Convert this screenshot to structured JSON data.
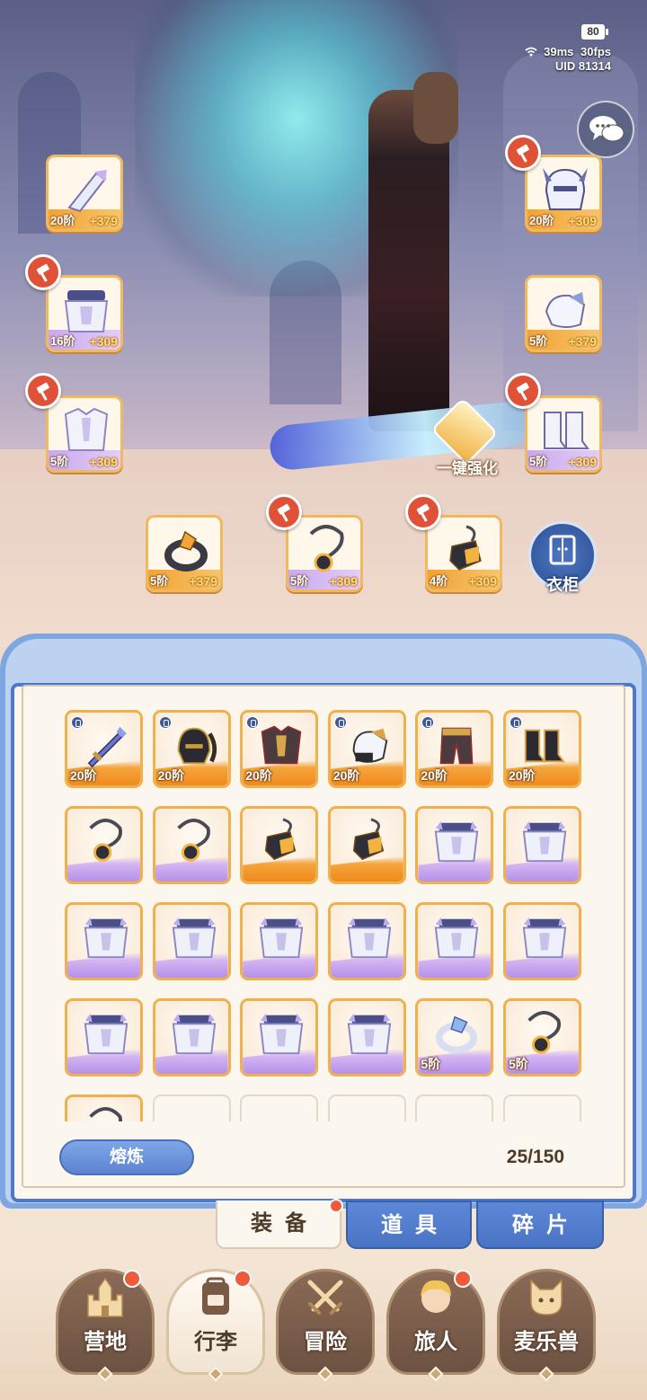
{
  "status": {
    "battery": "80",
    "ping": "39ms",
    "fps": "30fps",
    "uid": "UID  81314"
  },
  "equipped": [
    {
      "tier": "20阶",
      "plus": "+379",
      "item": "bracer",
      "hammer": false
    },
    {
      "tier": "16阶",
      "plus": "+309",
      "item": "armor",
      "hammer": true
    },
    {
      "tier": "5阶",
      "plus": "+309",
      "item": "chest",
      "hammer": true
    },
    {
      "tier": "20阶",
      "plus": "+309",
      "item": "helm",
      "hammer": true
    },
    {
      "tier": "5阶",
      "plus": "+379",
      "item": "gauntlet",
      "hammer": false
    },
    {
      "tier": "5阶",
      "plus": "+309",
      "item": "boots",
      "hammer": true
    },
    {
      "tier": "5阶",
      "plus": "+379",
      "item": "ring",
      "hammer": false
    },
    {
      "tier": "5阶",
      "plus": "+309",
      "item": "necklace",
      "hammer": true
    },
    {
      "tier": "4阶",
      "plus": "+309",
      "item": "pendant",
      "hammer": true
    }
  ],
  "actions": {
    "one_click": "一键强化",
    "wardrobe": "衣柜"
  },
  "inventory": {
    "rows": [
      [
        {
          "tier": "20阶",
          "item": "sword",
          "rarity": "orange",
          "locked": true
        },
        {
          "tier": "20阶",
          "item": "helmet",
          "rarity": "orange",
          "locked": true
        },
        {
          "tier": "20阶",
          "item": "chestplate",
          "rarity": "orange",
          "locked": true
        },
        {
          "tier": "20阶",
          "item": "glove",
          "rarity": "orange",
          "locked": true
        },
        {
          "tier": "20阶",
          "item": "leggings",
          "rarity": "orange",
          "locked": true
        },
        {
          "tier": "20阶",
          "item": "boots",
          "rarity": "orange",
          "locked": true
        }
      ],
      [
        {
          "tier": "",
          "item": "necklace",
          "rarity": "purple",
          "locked": false
        },
        {
          "tier": "",
          "item": "necklace",
          "rarity": "purple",
          "locked": false
        },
        {
          "tier": "",
          "item": "pendant",
          "rarity": "orange",
          "locked": false
        },
        {
          "tier": "",
          "item": "pendant",
          "rarity": "orange",
          "locked": false
        },
        {
          "tier": "",
          "item": "armor",
          "rarity": "purple",
          "locked": false
        },
        {
          "tier": "",
          "item": "armor",
          "rarity": "purple",
          "locked": false
        }
      ],
      [
        {
          "tier": "",
          "item": "armor",
          "rarity": "purple",
          "locked": false
        },
        {
          "tier": "",
          "item": "armor",
          "rarity": "purple",
          "locked": false
        },
        {
          "tier": "",
          "item": "armor",
          "rarity": "purple",
          "locked": false
        },
        {
          "tier": "",
          "item": "armor",
          "rarity": "purple",
          "locked": false
        },
        {
          "tier": "",
          "item": "armor",
          "rarity": "purple",
          "locked": false
        },
        {
          "tier": "",
          "item": "armor",
          "rarity": "purple",
          "locked": false
        }
      ],
      [
        {
          "tier": "",
          "item": "armor",
          "rarity": "purple",
          "locked": false
        },
        {
          "tier": "",
          "item": "armor",
          "rarity": "purple",
          "locked": false
        },
        {
          "tier": "",
          "item": "armor",
          "rarity": "purple",
          "locked": false
        },
        {
          "tier": "",
          "item": "armor",
          "rarity": "purple",
          "locked": false
        },
        {
          "tier": "5阶",
          "item": "ring",
          "rarity": "purple",
          "locked": false
        },
        {
          "tier": "5阶",
          "item": "necklace",
          "rarity": "purple",
          "locked": false
        }
      ],
      [
        {
          "tier": "",
          "item": "necklace",
          "rarity": "purple",
          "locked": false
        },
        {
          "tier": "",
          "item": "",
          "rarity": "empty",
          "locked": false
        },
        {
          "tier": "",
          "item": "",
          "rarity": "empty",
          "locked": false
        },
        {
          "tier": "",
          "item": "",
          "rarity": "empty",
          "locked": false
        },
        {
          "tier": "",
          "item": "",
          "rarity": "empty",
          "locked": false
        },
        {
          "tier": "",
          "item": "",
          "rarity": "empty",
          "locked": false
        }
      ]
    ],
    "smelt_label": "熔炼",
    "capacity": "25/150"
  },
  "tabs": [
    {
      "label": "装备",
      "active": true,
      "badge": true
    },
    {
      "label": "道具",
      "active": false,
      "badge": false
    },
    {
      "label": "碎片",
      "active": false,
      "badge": false
    }
  ],
  "nav": [
    {
      "label": "营地",
      "icon": "castle-icon",
      "badge": true,
      "active": false
    },
    {
      "label": "行李",
      "icon": "backpack-icon",
      "badge": true,
      "active": true
    },
    {
      "label": "冒险",
      "icon": "crossed-swords-icon",
      "badge": false,
      "active": false
    },
    {
      "label": "旅人",
      "icon": "traveler-portrait-icon",
      "badge": true,
      "active": false
    },
    {
      "label": "麦乐兽",
      "icon": "pet-icon",
      "badge": false,
      "active": false
    }
  ],
  "colors": {
    "orange_rarity": "#f08a1c",
    "purple_rarity": "#b690e8",
    "panel_border": "#4f79c6",
    "badge": "#ef5a3a"
  }
}
